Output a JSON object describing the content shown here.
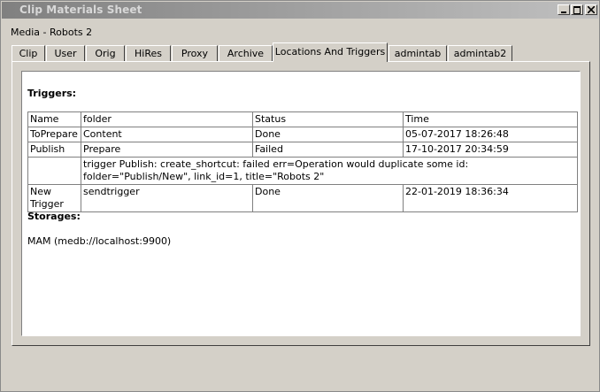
{
  "window": {
    "title": "Clip Materials Sheet"
  },
  "media": {
    "label": "Media - Robots 2"
  },
  "tabs": [
    {
      "label": "Clip"
    },
    {
      "label": "User"
    },
    {
      "label": "Orig"
    },
    {
      "label": "HiRes"
    },
    {
      "label": "Proxy"
    },
    {
      "label": "Archive"
    },
    {
      "label": "Locations And Triggers"
    },
    {
      "label": "admintab"
    },
    {
      "label": "admintab2"
    }
  ],
  "active_tab": "Locations And Triggers",
  "triggers": {
    "heading": "Triggers:",
    "columns": [
      "Name",
      "folder",
      "Status",
      "Time"
    ],
    "rows": [
      {
        "name": "ToPrepare",
        "folder": "Content",
        "status": "Done",
        "time": "05-07-2017 18:26:48"
      },
      {
        "name": "Publish",
        "folder": "Prepare",
        "status": "Failed",
        "time": "17-10-2017 20:34:59"
      },
      {
        "detail": "trigger Publish: create_shortcut: failed err=Operation would duplicate some id: folder=\"Publish/New\", link_id=1, title=\"Robots 2\""
      },
      {
        "name": "New Trigger",
        "folder": "sendtrigger",
        "status": "Done",
        "time": "22-01-2019 18:36:34"
      }
    ]
  },
  "storages": {
    "heading": "Storages:",
    "items": [
      "MAM (medb://localhost:9900)"
    ]
  }
}
